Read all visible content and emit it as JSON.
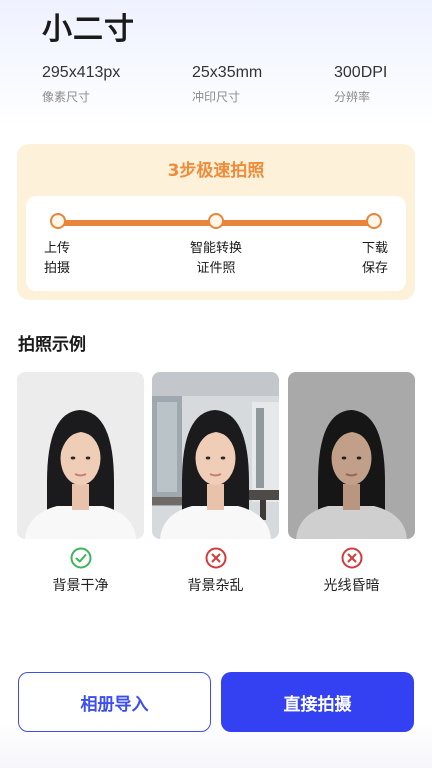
{
  "header": {
    "title": "小二寸"
  },
  "specs": [
    {
      "value": "295x413px",
      "label": "像素尺寸"
    },
    {
      "value": "25x35mm",
      "label": "冲印尺寸"
    },
    {
      "value": "300DPI",
      "label": "分辨率"
    }
  ],
  "steps": {
    "heading": "3步极速拍照",
    "items": [
      {
        "line1": "上传",
        "line2": "拍摄"
      },
      {
        "line1": "智能转换",
        "line2": "证件照"
      },
      {
        "line1": "下载",
        "line2": "保存"
      }
    ],
    "accent_color": "#e8843b"
  },
  "examples": {
    "title": "拍照示例",
    "items": [
      {
        "label": "背景干净",
        "status": "ok",
        "icon": "check-circle-icon",
        "color": "#3cb45a"
      },
      {
        "label": "背景杂乱",
        "status": "bad",
        "icon": "x-circle-icon",
        "color": "#d33b3b"
      },
      {
        "label": "光线昏暗",
        "status": "bad",
        "icon": "x-circle-icon",
        "color": "#d33b3b"
      }
    ]
  },
  "actions": {
    "album_label": "相册导入",
    "shoot_label": "直接拍摄",
    "primary_color": "#3341f2"
  }
}
